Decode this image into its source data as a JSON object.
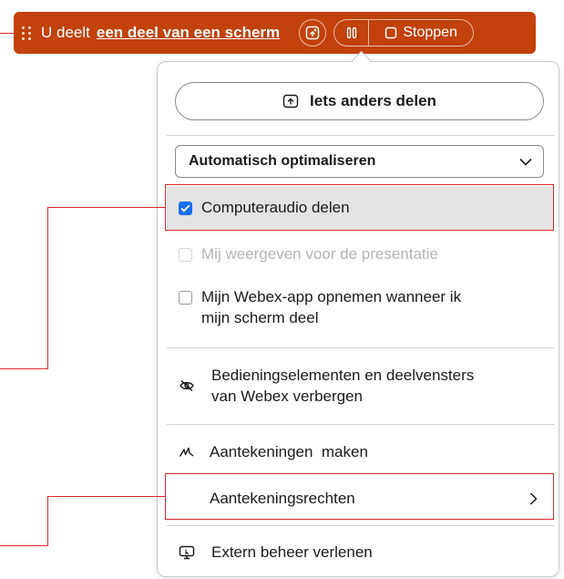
{
  "share_bar": {
    "prefix": "U deelt",
    "link": "een deel van een scherm",
    "stop_label": "Stoppen",
    "bg_color": "#c2410c"
  },
  "panel": {
    "share_other_label": "Iets anders delen",
    "optimize_select": {
      "selected": "Automatisch optimaliseren"
    },
    "items": {
      "computer_audio": {
        "label": "Computeraudio delen",
        "checked": true
      },
      "show_me": {
        "label": "Mij weergeven voor de presentatie",
        "checked": false,
        "disabled": true
      },
      "record_app": {
        "label_line1": "Mijn Webex-app opnemen wanneer ik",
        "label_line2": "mijn scherm deel",
        "checked": false
      },
      "hide_controls": {
        "label_line1": "Bedieningselementen en deelvensters",
        "label_line2": "van Webex verbergen",
        "icon": "eye-off-icon"
      },
      "annotate": {
        "label": "Aantekeningen  maken",
        "icon": "pen-scribble-icon"
      },
      "annotation_rights": {
        "label": "Aantekeningsrechten",
        "icon": "chevron-right-icon"
      },
      "remote_control": {
        "label": "Extern beheer verlenen",
        "icon": "remote-desktop-icon"
      }
    }
  },
  "colors": {
    "accent_checkbox": "#1a6ff2",
    "annotation_red": "#d92b2b",
    "highlight_row": "#e3e3e3"
  }
}
